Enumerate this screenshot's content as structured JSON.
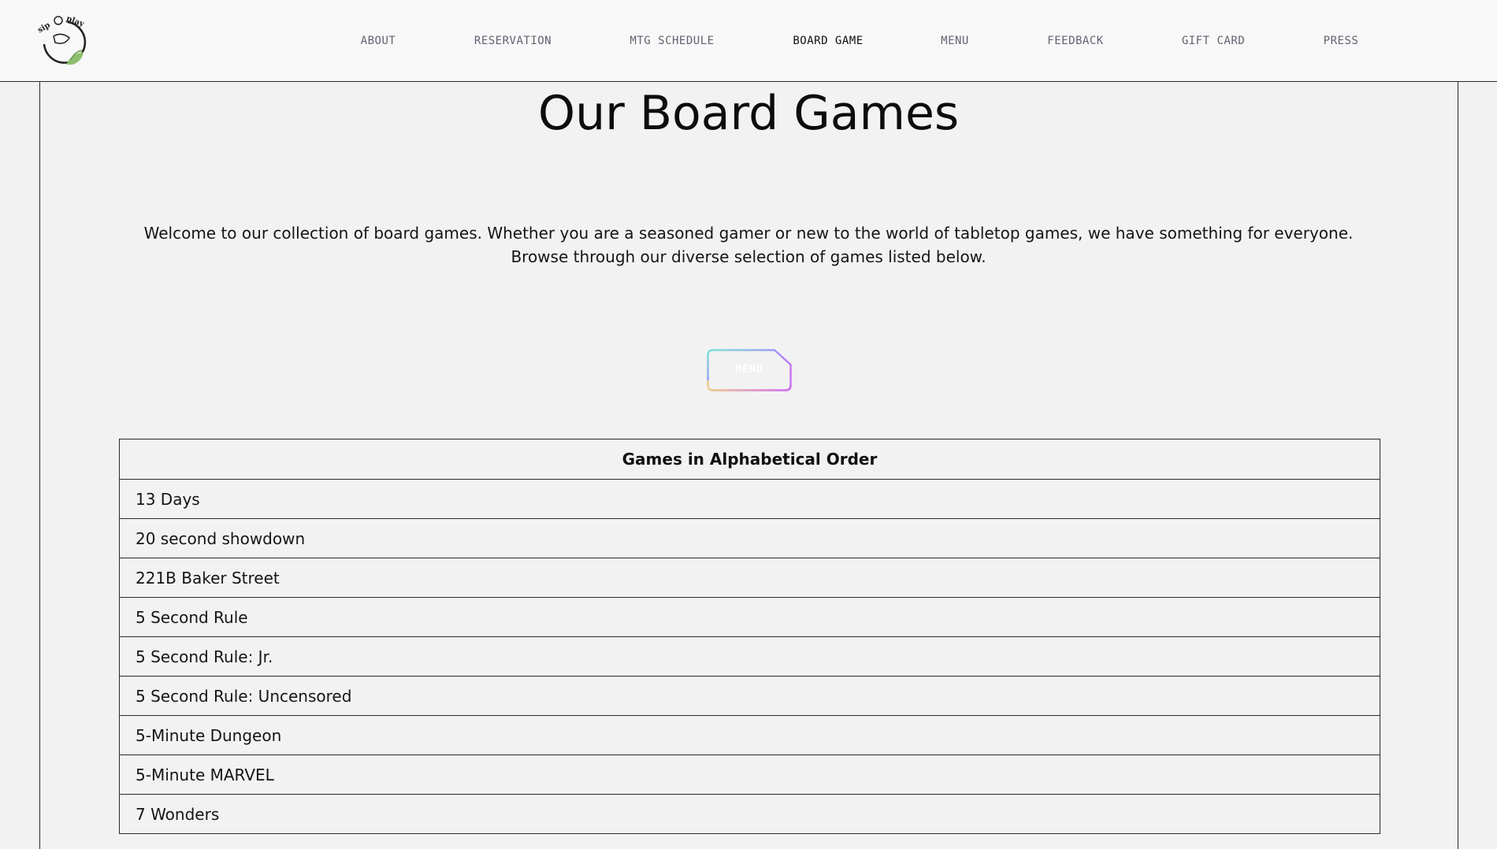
{
  "header": {
    "logo_text": "sip & play",
    "nav": [
      {
        "label": "ABOUT",
        "active": false
      },
      {
        "label": "RESERVATION",
        "active": false
      },
      {
        "label": "MTG SCHEDULE",
        "active": false
      },
      {
        "label": "BOARD GAME",
        "active": true
      },
      {
        "label": "MENU",
        "active": false
      },
      {
        "label": "FEEDBACK",
        "active": false
      },
      {
        "label": "GIFT CARD",
        "active": false
      },
      {
        "label": "PRESS",
        "active": false
      }
    ]
  },
  "main": {
    "title": "Our Board Games",
    "intro_line1": "Welcome to our collection of board games. Whether you are a seasoned gamer or new to the world of tabletop games, we have something for everyone.",
    "intro_line2": "Browse through our diverse selection of games listed below.",
    "menu_button_label": "MENU",
    "table": {
      "header": "Games in Alphabetical Order",
      "rows": [
        "13 Days",
        "20 second showdown",
        "221B Baker Street",
        "5 Second Rule",
        "5 Second Rule: Jr.",
        "5 Second Rule: Uncensored",
        "5-Minute Dungeon",
        "5-Minute MARVEL",
        "7 Wonders"
      ]
    }
  },
  "colors": {
    "background": "#f2f2f2",
    "header_bg": "#f8f8f8",
    "nav_text": "#5f6470",
    "nav_active": "#111111",
    "logo_leaf": "#8dbf6e",
    "button_gradient": [
      "#7fe3d6",
      "#a78bfa",
      "#d070f0",
      "#f2d38a"
    ]
  }
}
